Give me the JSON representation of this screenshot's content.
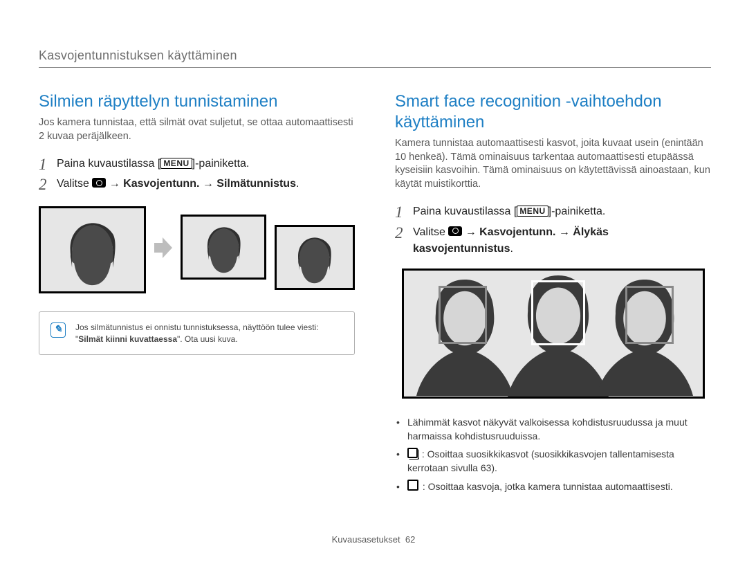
{
  "header": "Kasvojentunnistuksen käyttäminen",
  "left": {
    "title": "Silmien räpyttelyn tunnistaminen",
    "intro": "Jos kamera tunnistaa, että silmät ovat suljetut, se ottaa automaattisesti 2 kuvaa peräjälkeen.",
    "step1_pre": "Paina kuvaustilassa [",
    "step1_menu": "MENU",
    "step1_post": "]-painiketta.",
    "step2_pre": "Valitse ",
    "step2_bold1": " → Kasvojentunn. → Silmätunnistus",
    "step2_end": ".",
    "note_pre": "Jos silmätunnistus ei onnistu tunnistuksessa, näyttöön tulee viesti: \"",
    "note_bold": "Silmät kiinni kuvattaessa",
    "note_post": "\". Ota uusi kuva."
  },
  "right": {
    "title": "Smart face recognition -vaihtoehdon käyttäminen",
    "intro": "Kamera tunnistaa automaattisesti kasvot, joita kuvaat usein (enintään 10 henkeä). Tämä ominaisuus tarkentaa automaattisesti etupäässä kyseisiin kasvoihin. Tämä ominaisuus on käytettävissä ainoastaan, kun käytät muistikorttia.",
    "step1_pre": "Paina kuvaustilassa [",
    "step1_menu": "MENU",
    "step1_post": "]-painiketta.",
    "step2_pre": "Valitse ",
    "step2_bold1": " → Kasvojentunn. → Älykäs kasvojentunnistus",
    "step2_end": ".",
    "bullet1": "Lähimmät kasvot näkyvät valkoisessa kohdistusruudussa ja muut harmaissa kohdistusruuduissa.",
    "bullet2_post": " : Osoittaa suosikkikasvot (suosikkikasvojen tallentamisesta kerrotaan sivulla 63).",
    "bullet3_post": " : Osoittaa kasvoja, jotka kamera tunnistaa automaattisesti."
  },
  "footer_label": "Kuvausasetukset",
  "footer_page": "62"
}
